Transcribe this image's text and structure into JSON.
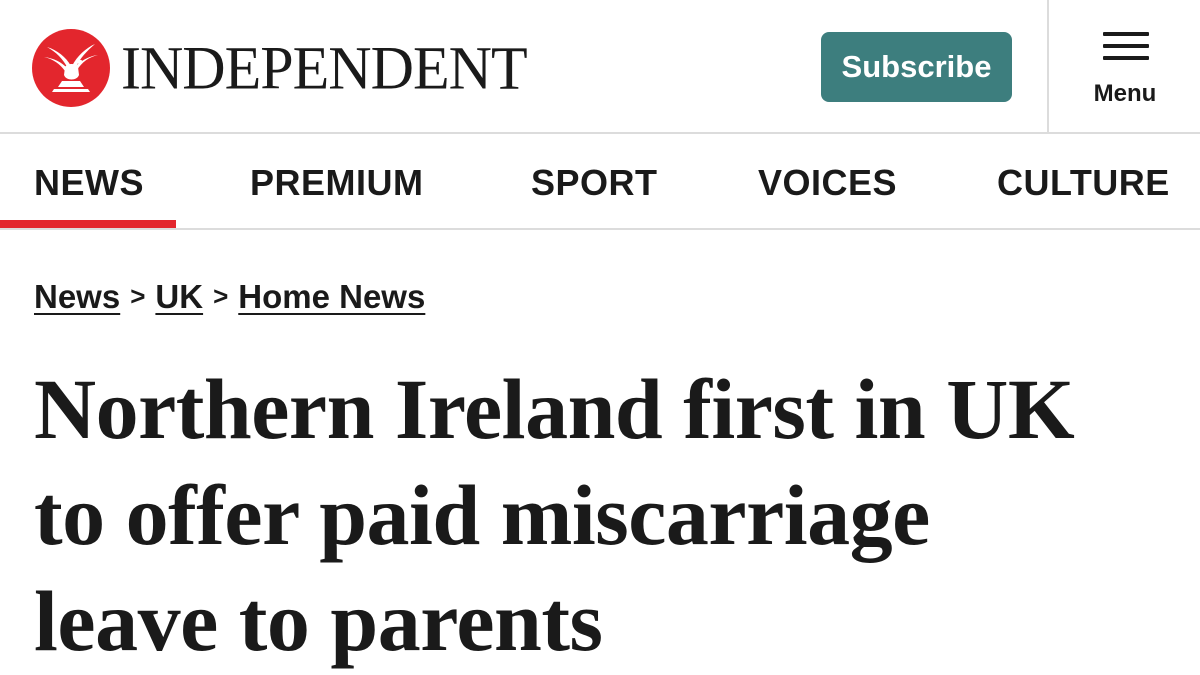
{
  "brand": {
    "name": "INDEPENDENT",
    "accent_color": "#e3262d",
    "logo_icon": "eagle-icon"
  },
  "header": {
    "subscribe_label": "Subscribe",
    "subscribe_color": "#3d7e7e",
    "menu_label": "Menu",
    "menu_icon": "hamburger-icon"
  },
  "nav": {
    "items": [
      {
        "label": "NEWS",
        "active": true
      },
      {
        "label": "PREMIUM",
        "active": false
      },
      {
        "label": "SPORT",
        "active": false
      },
      {
        "label": "VOICES",
        "active": false
      },
      {
        "label": "CULTURE",
        "active": false
      }
    ]
  },
  "breadcrumb": {
    "items": [
      "News",
      "UK",
      "Home News"
    ],
    "separator": ">"
  },
  "article": {
    "headline_lines": [
      "Northern Ireland first in UK",
      "to offer paid miscarriage",
      "leave to parents"
    ]
  }
}
